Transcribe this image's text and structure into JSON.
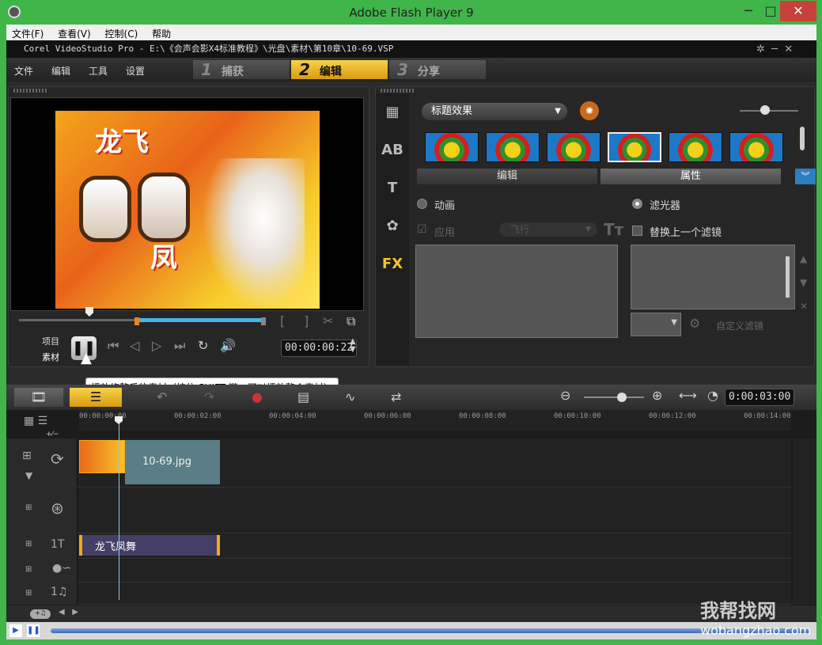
{
  "window": {
    "title": "Adobe Flash Player 9",
    "minimize": "─",
    "maximize": "□",
    "close": "✕"
  },
  "menubar": [
    "文件(F)",
    "查看(V)",
    "控制(C)",
    "帮助"
  ],
  "app": {
    "title": "Corel VideoStudio Pro - E:\\《会声会影X4标准教程》\\光盘\\素材\\第10章\\10-69.VSP"
  },
  "topmenu": [
    "文件",
    "编辑",
    "工具",
    "设置"
  ],
  "steps": [
    {
      "num": "1",
      "label": "捕获"
    },
    {
      "num": "2",
      "label": "编辑"
    },
    {
      "num": "3",
      "label": "分享"
    }
  ],
  "preview": {
    "title_top": "龙飞",
    "title_bottom": "凤",
    "mode_project": "项目",
    "mode_clip": "素材",
    "timecode": "00:00:00:22"
  },
  "tooltip": "播放修整后的素材（按住 SHIFT 键，可以播放整个素材）",
  "effects": {
    "dropdown": "标题效果",
    "subtab_edit": "编辑",
    "subtab_attr": "属性",
    "animation": "动画",
    "filter": "滤光器",
    "apply": "应用",
    "fly": "飞行",
    "replace_last": "替换上一个滤镜",
    "custom_filter": "自定义滤镜"
  },
  "sidetabs": [
    "▦",
    "AB",
    "T",
    "✿",
    "FX"
  ],
  "timeline": {
    "timecode": "0:00:03:00",
    "ticks": [
      "00:00:00:00",
      "00:00:02:00",
      "00:00:04:00",
      "00:00:06:00",
      "00:00:08:00",
      "00:00:10:00",
      "00:00:12:00",
      "00:00:14:00"
    ],
    "clip_label": "10-69.jpg",
    "title_clip": "龙飞凤舞",
    "zoom_ops": "+⁄−"
  },
  "track_labels": [
    "",
    "",
    "1T",
    "",
    ""
  ],
  "watermark": {
    "main": "我帮找网",
    "url": "wobangzhao.com"
  }
}
